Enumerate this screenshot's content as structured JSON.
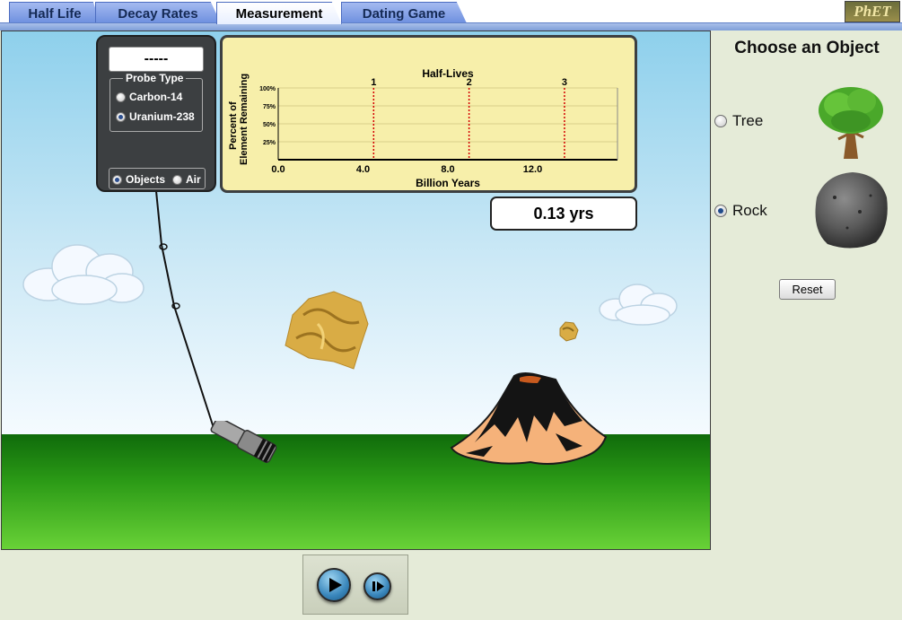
{
  "tabs": [
    {
      "label": "Half Life",
      "active": false
    },
    {
      "label": "Decay Rates",
      "active": false
    },
    {
      "label": "Measurement",
      "active": true
    },
    {
      "label": "Dating Game",
      "active": false
    }
  ],
  "logo_text": "PhET",
  "probe": {
    "readout": "-----",
    "type_title": "Probe Type",
    "options": [
      "Carbon-14",
      "Uranium-238"
    ],
    "selected_option": "Uranium-238",
    "target_options": [
      "Objects",
      "Air"
    ],
    "selected_target": "Objects"
  },
  "graph": {
    "title": "Half-Lives",
    "ylabel_line1": "Percent of",
    "ylabel_line2": "Element Remaining",
    "xlabel": "Billion Years",
    "y_ticks": [
      "100%",
      "75%",
      "50%",
      "25%"
    ],
    "x_ticks": [
      "0.0",
      "4.0",
      "8.0",
      "12.0"
    ],
    "half_life_marks": [
      "1",
      "2",
      "3"
    ]
  },
  "chart_data": {
    "type": "line",
    "title": "Half-Lives",
    "xlabel": "Billion Years",
    "ylabel": "Percent of Element Remaining",
    "xlim": [
      0,
      16
    ],
    "ylim": [
      0,
      100
    ],
    "x_ticks": [
      0,
      4,
      8,
      12
    ],
    "y_ticks": [
      25,
      50,
      75,
      100
    ],
    "half_life_lines_x": [
      4.5,
      9.0,
      13.5
    ],
    "half_life_labels": [
      "1",
      "2",
      "3"
    ],
    "series": [],
    "grid": true
  },
  "time_readout": {
    "value": "0.13",
    "unit": "yrs"
  },
  "controls": {
    "play_label": "play",
    "step_label": "step"
  },
  "right_panel": {
    "title": "Choose an Object",
    "objects": [
      {
        "label": "Tree",
        "selected": false
      },
      {
        "label": "Rock",
        "selected": true
      }
    ],
    "reset_label": "Reset"
  },
  "colors": {
    "tab_active": "#ffffff",
    "tab_inactive": "#8aa6e8",
    "graph_bg": "#f7efaa",
    "half_life_line": "#d40000",
    "ground": "#2b9a16",
    "volcano": "#f5b27a"
  }
}
